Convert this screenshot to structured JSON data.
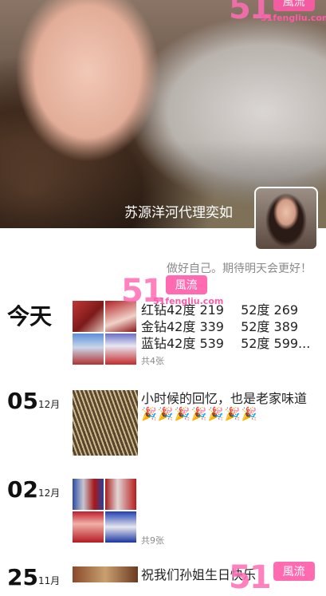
{
  "header": {
    "name": "苏源洋河代理奕如",
    "signature": "做好自己。期待明天会更好！"
  },
  "watermark": {
    "number": "51",
    "tag": "風流",
    "site": "51fengliu.com"
  },
  "posts": [
    {
      "date_label": "今天",
      "lines": [
        "红钻42度 219　 52度 269",
        "金钻42度 339　 52度 389",
        "蓝钻42度 539　 52度 599..."
      ],
      "photo_count": "共4张"
    },
    {
      "day": "05",
      "month": "12月",
      "text": "小时候的回忆，也是老家味道",
      "emojis": "🎉🎉🎉🎉🎉🎉🎉"
    },
    {
      "day": "02",
      "month": "12月",
      "photo_count": "共9张"
    },
    {
      "day": "25",
      "month": "11月",
      "text": "祝我们孙姐生日快乐"
    }
  ]
}
